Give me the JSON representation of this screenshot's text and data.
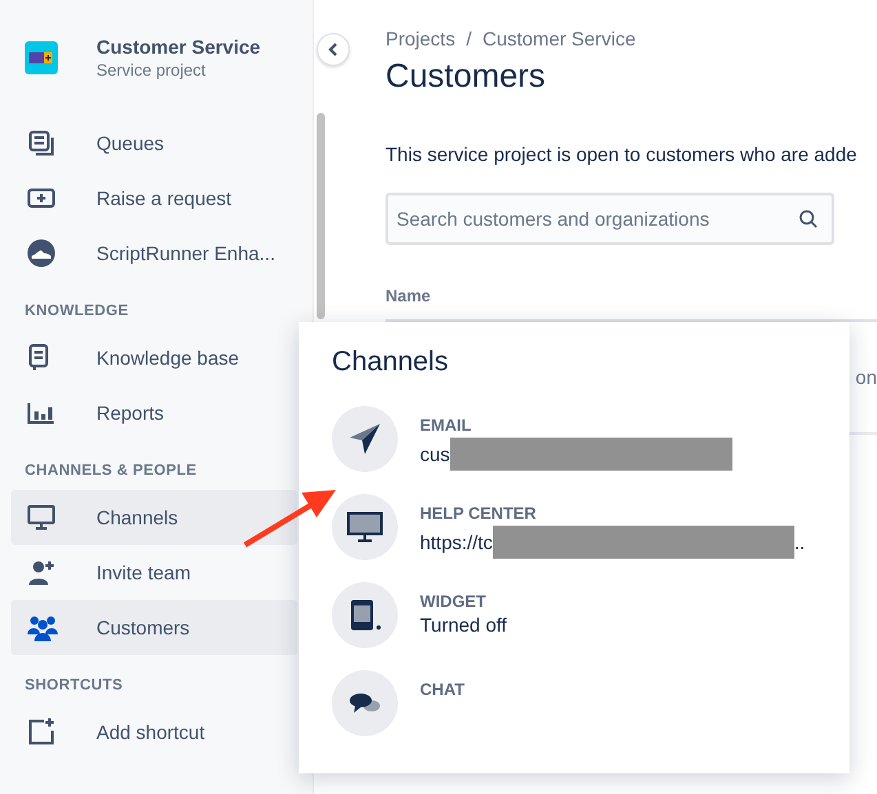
{
  "project": {
    "name": "Customer Service",
    "type": "Service project"
  },
  "sidebar": {
    "sections": [
      {
        "items": [
          {
            "label": "Queues",
            "highlighted": false
          },
          {
            "label": "Raise a request",
            "highlighted": false
          },
          {
            "label": "ScriptRunner Enha...",
            "highlighted": false
          }
        ]
      },
      {
        "heading": "KNOWLEDGE",
        "items": [
          {
            "label": "Knowledge base",
            "highlighted": false
          },
          {
            "label": "Reports",
            "highlighted": false
          }
        ]
      },
      {
        "heading": "CHANNELS & PEOPLE",
        "items": [
          {
            "label": "Channels",
            "highlighted": true
          },
          {
            "label": "Invite team",
            "highlighted": false
          },
          {
            "label": "Customers",
            "highlighted": true
          }
        ]
      },
      {
        "heading": "SHORTCUTS",
        "items": [
          {
            "label": "Add shortcut",
            "highlighted": false
          }
        ]
      }
    ]
  },
  "breadcrumbs": [
    "Projects",
    "Customer Service"
  ],
  "breadcrumb_separator": "/",
  "page_title": "Customers",
  "description": "This service project is open to customers who are adde",
  "search": {
    "placeholder": "Search customers and organizations"
  },
  "table": {
    "columns": [
      "Name"
    ],
    "row_fragment": "on"
  },
  "channels_popup": {
    "title": "Channels",
    "channels": [
      {
        "label": "EMAIL",
        "value": "cus",
        "redacted": true
      },
      {
        "label": "HELP CENTER",
        "value": "https://tc",
        "redacted": true,
        "value_tail": ".."
      },
      {
        "label": "WIDGET",
        "value": "Turned off"
      },
      {
        "label": "CHAT"
      }
    ]
  }
}
